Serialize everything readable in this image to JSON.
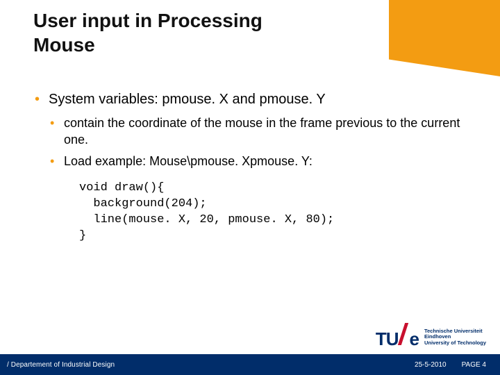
{
  "title": {
    "line1": "User input in Processing",
    "line2": "Mouse"
  },
  "bullets": {
    "l1": "System variables: pmouse. X and pmouse. Y",
    "l2a": "contain the coordinate of the mouse in the frame previous to the current one.",
    "l2b": "Load example: Mouse\\pmouse. Xpmouse. Y:"
  },
  "code": "void draw(){\n  background(204);\n  line(mouse. X, 20, pmouse. X, 80);\n}",
  "footer": {
    "left": "/ Departement of Industrial Design",
    "date": "25-5-2010",
    "page": "PAGE 4"
  },
  "logo": {
    "tu": "TU",
    "e": "e",
    "line1": "Technische Universiteit",
    "line2": "Eindhoven",
    "line3": "University of Technology"
  }
}
